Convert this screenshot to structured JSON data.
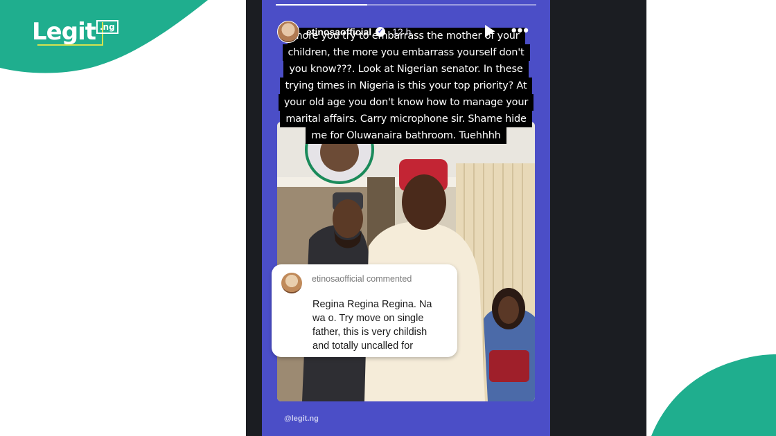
{
  "brand": {
    "logo_main": "Legit",
    "logo_suffix": ".ng",
    "accent_color": "#1fae8e",
    "accent_outline": "#d6e34e"
  },
  "story": {
    "username": "etinosaofficial",
    "verified_mark": "✓",
    "time": "12 h",
    "progress": 0.35,
    "background_color": "#4b4ec7",
    "play_icon": "play-icon",
    "more_icon": "more-icon",
    "more_glyph": "•••",
    "overlay_lines": [
      "more you try to embarrass the mother of your",
      "children, the more you embarrass yourself don't",
      "you know???. Look at Nigerian senator. In these",
      "trying times in Nigeria is this your top priority? At",
      "your old age you don't know how to manage your",
      "marital affairs. Carry microphone sir. Shame hide",
      "me for Oluwanaira bathroom. Tuehhhh"
    ],
    "comment": {
      "header": "etinosaofficial commented",
      "lines": [
        "Regina Regina Regina. Na",
        "wa o. Try move on single",
        "father, this is very childish",
        "and totally uncalled for"
      ]
    },
    "watermark": "@legit.ng"
  }
}
